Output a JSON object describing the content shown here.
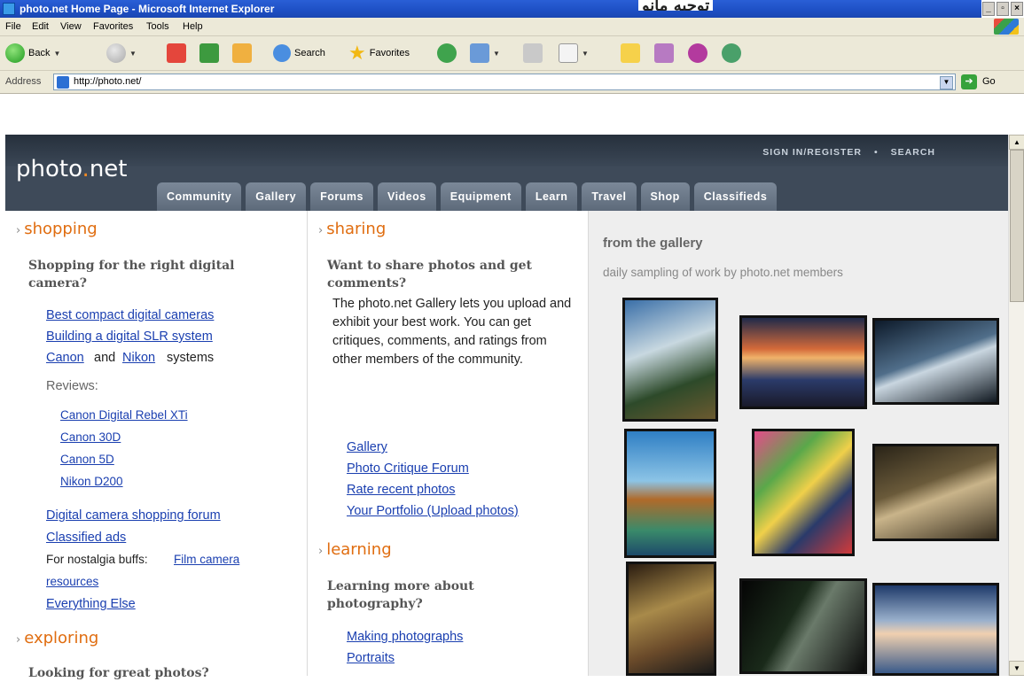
{
  "window": {
    "title": "photo.net Home Page - Microsoft Internet Explorer",
    "overlay_text": "ﺗﻮﺟﻴﻪ ﻣﺎﻧﻮ"
  },
  "menu": [
    "File",
    "Edit",
    "View",
    "Favorites",
    "Tools",
    "Help"
  ],
  "toolbar": {
    "back_label": "Back",
    "search_label": "Search",
    "favorites_label": "Favorites"
  },
  "address": {
    "label": "Address",
    "url": "http://photo.net/",
    "go_label": "Go"
  },
  "site": {
    "logo_text": "photo",
    "logo_dot": ".",
    "logo_suffix": "net",
    "sign_in": "SIGN IN/REGISTER",
    "separator": "•",
    "search": "SEARCH",
    "tabs": [
      "Community",
      "Gallery",
      "Forums",
      "Videos",
      "Equipment",
      "Learn",
      "Travel",
      "Shop",
      "Classifieds"
    ]
  },
  "shopping": {
    "heading": "shopping",
    "question": "Shopping for the right digital camera?",
    "link_compact": "Best compact digital cameras",
    "link_slr": "Building a digital SLR system",
    "link_canon": "Canon",
    "and_text": "and",
    "link_nikon": "Nikon",
    "systems_text": "systems",
    "reviews_label": "Reviews:",
    "reviews": [
      "Canon Digital Rebel XTi",
      "Canon 30D",
      "Canon 5D",
      "Nikon D200"
    ],
    "link_forum": "Digital camera shopping forum",
    "link_classified": "Classified ads",
    "nostalgia_text": "For nostalgia buffs:",
    "link_film": "Film camera",
    "link_resources": "resources",
    "link_else": "Everything Else"
  },
  "exploring": {
    "heading": "exploring",
    "question": "Looking for great photos?"
  },
  "sharing": {
    "heading": "sharing",
    "question": "Want to share photos and get comments?",
    "body": "The photo.net Gallery lets you upload and exhibit your best work. You can get critiques, comments, and ratings from other members of the community.",
    "links": [
      "Gallery",
      "Photo Critique Forum",
      "Rate recent photos",
      "Your Portfolio (Upload photos)"
    ]
  },
  "learning": {
    "heading": "learning",
    "question": "Learning more about photography?",
    "links": [
      "Making photographs",
      "Portraits"
    ]
  },
  "gallery": {
    "title": "from the gallery",
    "subtitle": "daily sampling of work by photo.net members"
  }
}
